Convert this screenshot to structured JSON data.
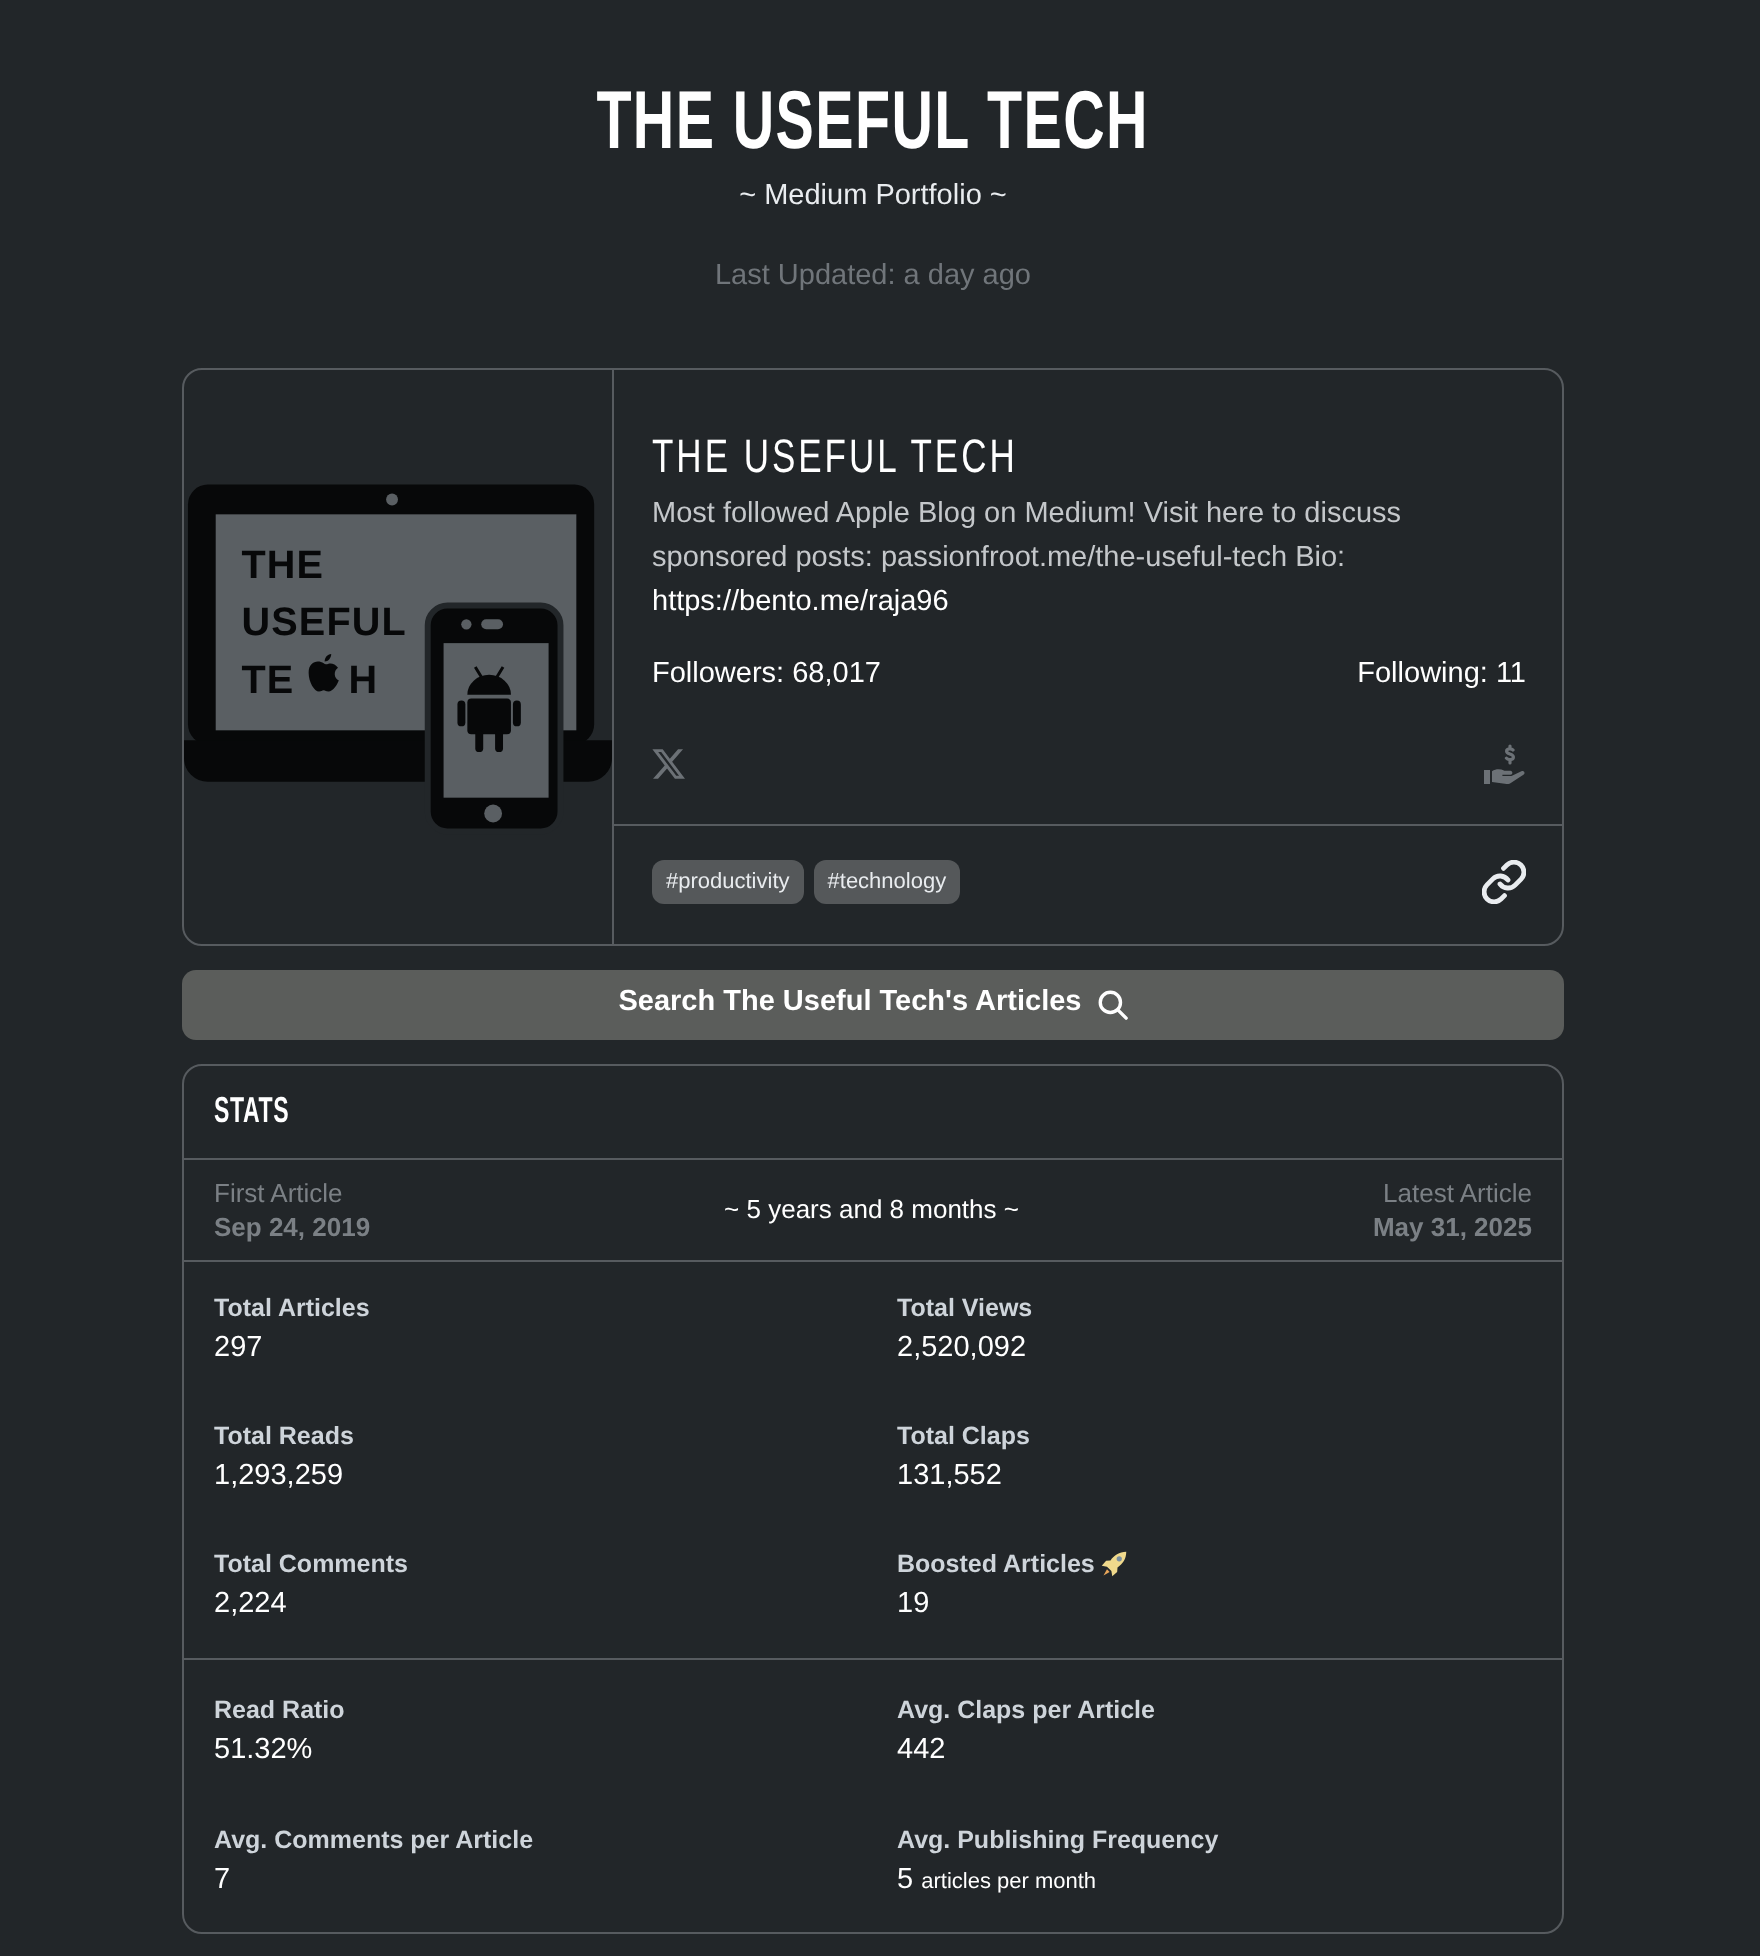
{
  "header": {
    "title": "THE USEFUL TECH",
    "subtitle": "~ Medium Portfolio ~",
    "last_updated": "Last Updated: a day ago"
  },
  "profile": {
    "logo": {
      "lines": [
        [
          "THE"
        ],
        [
          "USEFUL"
        ],
        [
          "TE",
          "H"
        ]
      ]
    },
    "name": "THE USEFUL TECH",
    "bio": "Most followed Apple Blog on Medium! Visit here to discuss sponsored posts: passionfroot.me/the-useful-tech Bio:",
    "bio_link": "https://bento.me/raja96",
    "followers": "Followers: 68,017",
    "following": "Following: 11",
    "tags": [
      "#productivity",
      "#technology"
    ]
  },
  "search_button": {
    "label": "Search The Useful Tech's Articles"
  },
  "stats": {
    "title": "STATS",
    "first_article": {
      "label": "First Article",
      "date": "Sep 24, 2019"
    },
    "span": "~ 5 years and 8 months ~",
    "latest_article": {
      "label": "Latest Article",
      "date": "May 31, 2025"
    },
    "groups": [
      [
        {
          "kind": "plain",
          "label": "Total Articles",
          "value": "297"
        },
        {
          "kind": "plain",
          "label": "Total Views",
          "value": "2,520,092"
        },
        {
          "kind": "plain",
          "label": "Total Reads",
          "value": "1,293,259"
        },
        {
          "kind": "plain",
          "label": "Total Claps",
          "value": "131,552"
        },
        {
          "kind": "plain",
          "label": "Total Comments",
          "value": "2,224"
        },
        {
          "kind": "boosted",
          "label": "Boosted Articles",
          "value": "19"
        }
      ],
      [
        {
          "kind": "plain",
          "label": "Read Ratio",
          "value": "51.32%"
        },
        {
          "kind": "plain",
          "label": "Avg. Claps per Article",
          "value": "442"
        },
        {
          "kind": "plain",
          "label": "Avg. Comments per Article",
          "value": "7"
        },
        {
          "kind": "plain",
          "label": "Avg. Publishing Frequency",
          "value": "5",
          "unit": "articles per month"
        }
      ]
    ]
  }
}
